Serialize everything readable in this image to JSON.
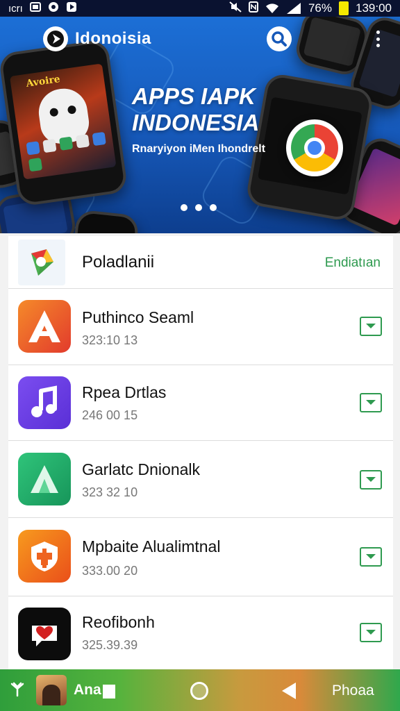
{
  "status_bar": {
    "left_glyph": "ıcrı",
    "battery_percent": "76%",
    "time": "139:00",
    "icons": [
      "image-icon",
      "record-icon",
      "play-icon",
      "mute-icon",
      "nfc-icon",
      "wifi-icon",
      "signal-icon",
      "battery-icon"
    ],
    "battery_color": "#f5e900"
  },
  "banner": {
    "brand_name": "Idonoisia",
    "phone_screen_title": "Avoire",
    "hero_title_line1": "APPS IAPK",
    "hero_title_line2": "INDONESIA",
    "hero_subtitle": "Rnaryiyon iMen Ihondrelt",
    "carousel_pages": 3,
    "icons": [
      "search-icon",
      "more-vert-icon",
      "brand-logo-icon",
      "chrome-icon"
    ],
    "background_color": "#1c6fd6"
  },
  "list": {
    "header": {
      "title": "Poladlanii",
      "action": "Endiatıan",
      "icon": "maps-icon"
    },
    "apps": [
      {
        "name": "Puthinco Seaml",
        "size": "323:10 13",
        "icon": "letter-a-icon",
        "icon_color": "#e8452c"
      },
      {
        "name": "Rpea Drtlas",
        "size": "246 00 15",
        "icon": "music-note-icon",
        "icon_color": "#6a3fe0"
      },
      {
        "name": "Garlatc Dnionalk",
        "size": "323 32 10",
        "icon": "triangle-a-icon",
        "icon_color": "#23a863"
      },
      {
        "name": "Mpbaite Alualimtnal",
        "size": "333.00 20",
        "icon": "shield-icon",
        "icon_color": "#f06a1c"
      },
      {
        "name": "Reofibonh",
        "size": "325.39.39",
        "icon": "heart-chat-icon",
        "icon_color": "#0c0c0c"
      }
    ],
    "download_icon": "download-chevron-icon",
    "accent_color": "#2e9a4f"
  },
  "bottom_bar": {
    "label": "Ana",
    "right_label": "Phoaa",
    "icons": [
      "signal-icon",
      "avatar",
      "square-icon",
      "home-circle-icon",
      "back-triangle-icon"
    ]
  }
}
